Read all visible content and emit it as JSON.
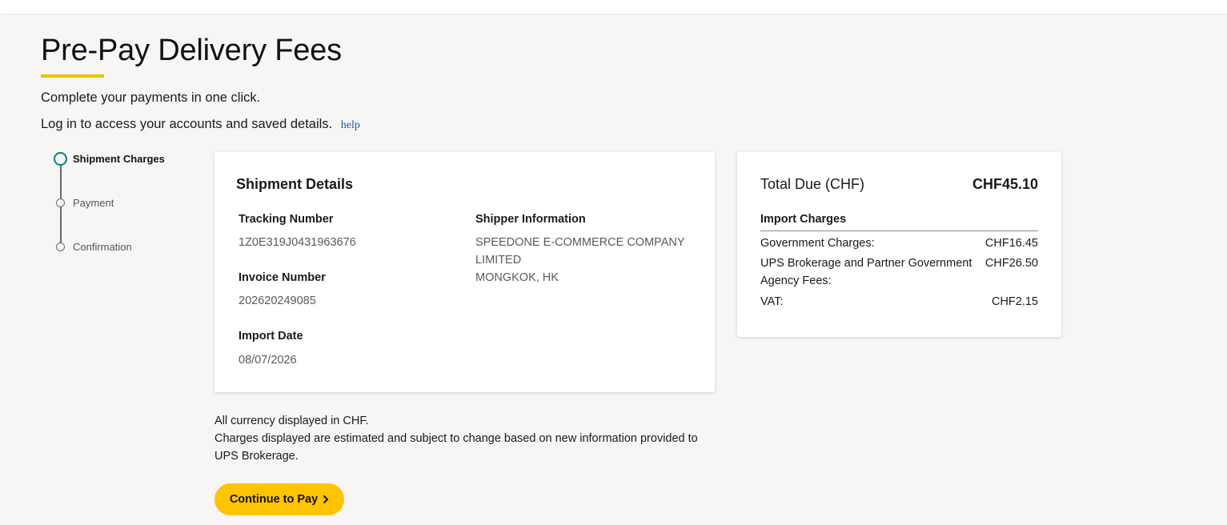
{
  "page": {
    "title": "Pre-Pay Delivery Fees",
    "intro_line1": "Complete your payments in one click.",
    "intro_line2": "Log in to access your accounts and saved details.",
    "help_link": "help"
  },
  "stepper": {
    "steps": [
      {
        "label": "Shipment Charges",
        "state": "active"
      },
      {
        "label": "Payment",
        "state": "pending"
      },
      {
        "label": "Confirmation",
        "state": "pending"
      }
    ]
  },
  "shipment_details": {
    "heading": "Shipment Details",
    "tracking_label": "Tracking Number",
    "tracking_value": "1Z0E319J0431963676",
    "invoice_label": "Invoice Number",
    "invoice_value": "202620249085",
    "import_date_label": "Import Date",
    "import_date_value": "08/07/2026",
    "shipper_label": "Shipper Information",
    "shipper_name": "SPEEDONE E-COMMERCE COMPANY LIMITED",
    "shipper_location": "MONGKOK, HK"
  },
  "total_due": {
    "heading": "Total Due (CHF)",
    "amount": "CHF45.10",
    "import_charges_heading": "Import Charges",
    "charges": [
      {
        "label": "Government Charges:",
        "value": "CHF16.45"
      },
      {
        "label": "UPS Brokerage and Partner Government Agency Fees:",
        "value": "CHF26.50"
      },
      {
        "label": "VAT:",
        "value": "CHF2.15"
      }
    ]
  },
  "notes": {
    "currency": "All currency displayed in CHF.",
    "disclaimer": "Charges displayed are estimated and subject to change based on new information provided to UPS Brokerage."
  },
  "actions": {
    "continue_label": "Continue to Pay"
  },
  "colors": {
    "accent_yellow": "#ffc400",
    "underline_yellow": "#e8c200",
    "active_step": "#0a7f86",
    "link_blue": "#1a55b5"
  }
}
